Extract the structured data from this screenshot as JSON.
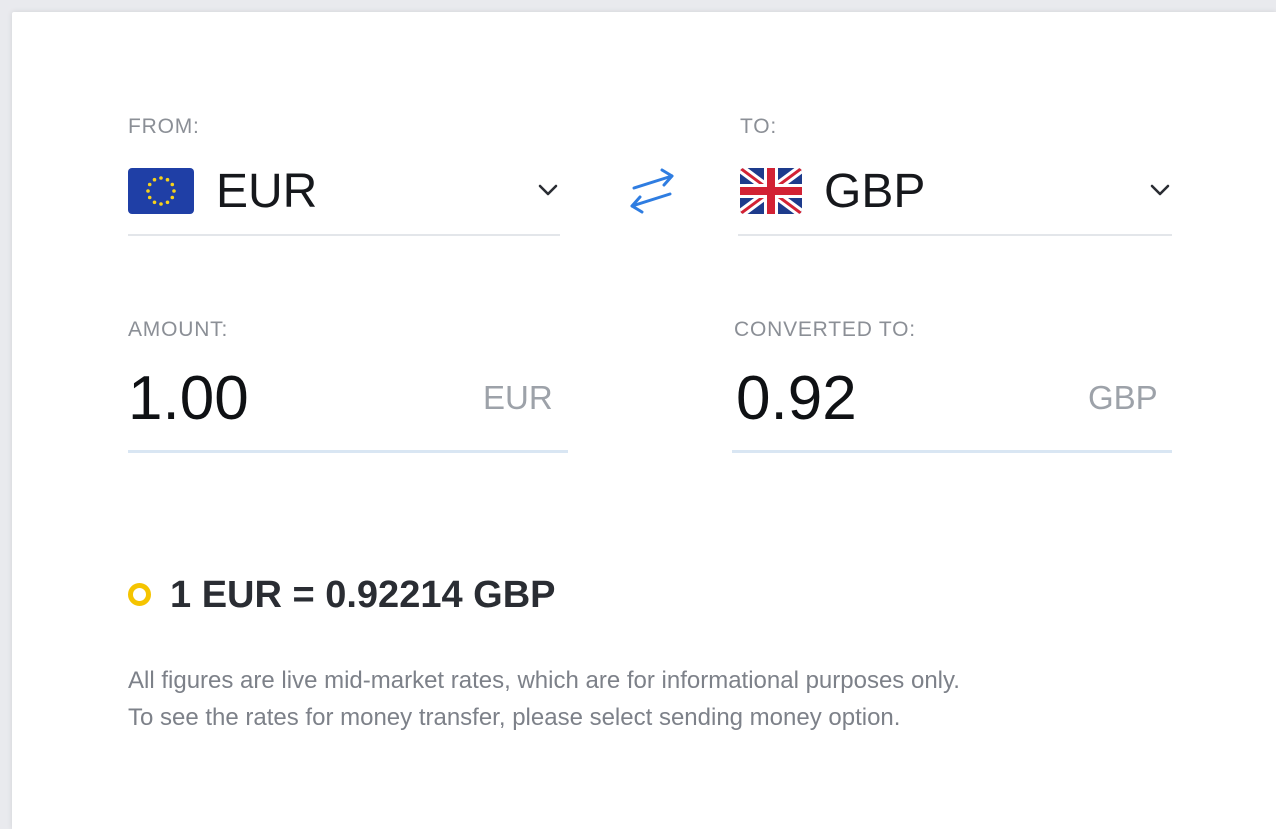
{
  "converter": {
    "from": {
      "label": "FROM:",
      "currency": "EUR",
      "flag_icon": "eu-flag-icon"
    },
    "to": {
      "label": "TO:",
      "currency": "GBP",
      "flag_icon": "uk-flag-icon"
    },
    "swap_icon": "swap-arrows-icon",
    "amount": {
      "label": "AMOUNT:",
      "value": "1.00",
      "unit": "EUR"
    },
    "converted": {
      "label": "CONVERTED TO:",
      "value": "0.92",
      "unit": "GBP"
    },
    "rate": {
      "text": "1 EUR = 0.92214 GBP"
    },
    "disclaimer": {
      "line1": "All figures are live mid-market rates, which are for informational purposes only.",
      "line2": "To see the rates for money transfer, please select sending money option."
    }
  },
  "colors": {
    "accent_blue": "#2f7de1",
    "rate_dot": "#f5c400",
    "underline_amount": "#d9e6f3",
    "underline_select": "#e3e6ea",
    "label_gray": "#8b8f96"
  }
}
